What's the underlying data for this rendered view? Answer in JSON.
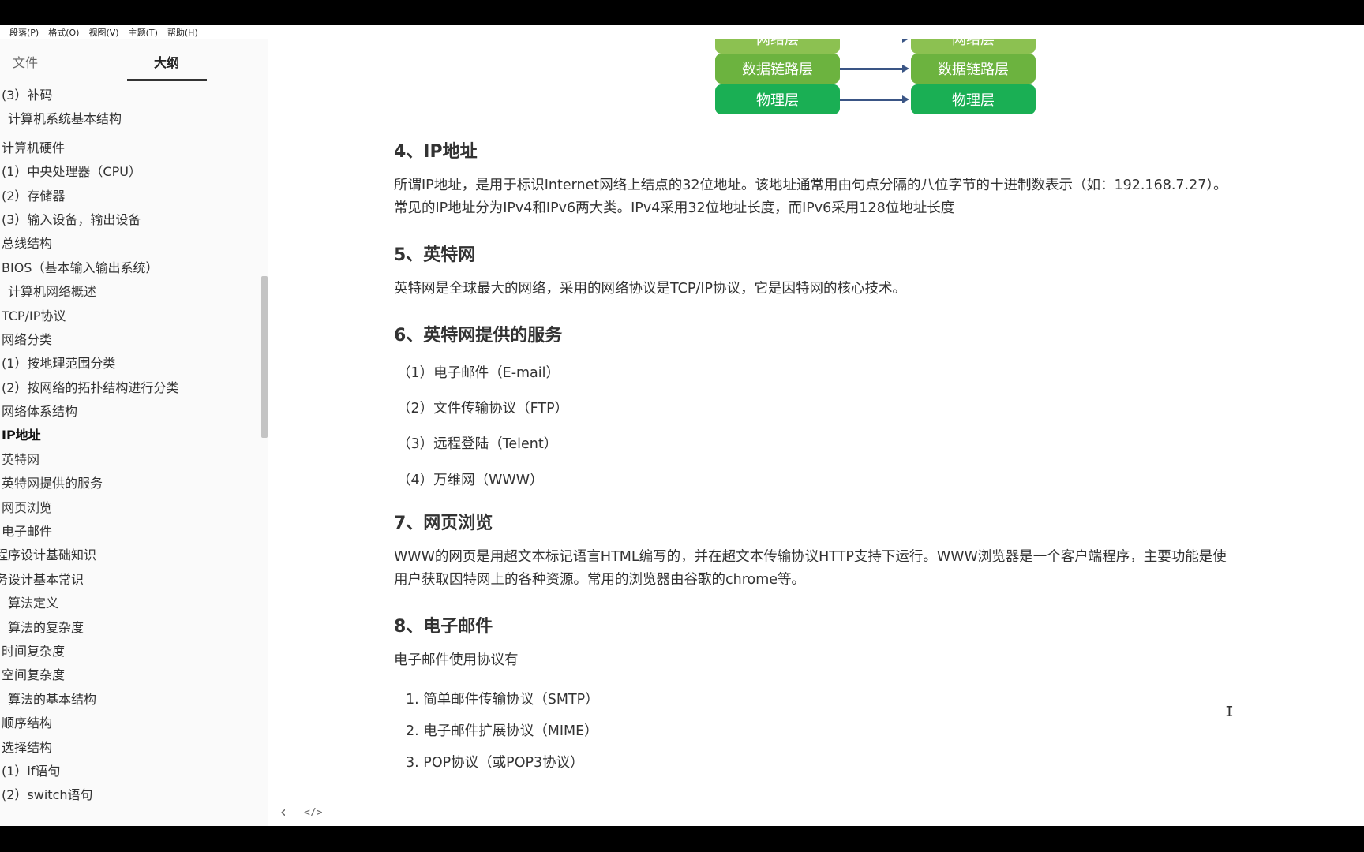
{
  "menubar": {
    "items": [
      "段落(P)",
      "格式(O)",
      "视图(V)",
      "主题(T)",
      "帮助(H)"
    ]
  },
  "sidebar": {
    "tab_files": "文件",
    "tab_outline": "大纲",
    "items": [
      "(3）补码",
      "计算机系统基本结构",
      "计算机硬件",
      "(1）中央处理器（CPU）",
      "(2）存储器",
      "(3）输入设备，输出设备",
      "总线结构",
      "BIOS（基本输入输出系统）",
      "计算机网络概述",
      "TCP/IP协议",
      "网络分类",
      "(1）按地理范围分类",
      "(2）按网络的拓扑结构进行分类",
      "网络体系结构",
      "IP地址",
      "英特网",
      "英特网提供的服务",
      "网页浏览",
      "电子邮件",
      "程序设计基础知识",
      "务设计基本常识",
      "算法定义",
      "算法的复杂度",
      "时间复杂度",
      "空间复杂度",
      "算法的基本结构",
      "顺序结构",
      "选择结构",
      "(1）if语句",
      "(2）switch语句"
    ]
  },
  "diagram": {
    "left_top": "网络层",
    "left_mid": "数据链路层",
    "left_bottom": "物理层",
    "right_top": "网络层",
    "right_mid": "数据链路层",
    "right_bottom": "物理层",
    "colors": {
      "light_green": "#8cc151",
      "mid_green": "#6cb33f",
      "bright_green": "#1aaf54",
      "arrow": "#3a5585"
    }
  },
  "doc": {
    "h4": "4、IP地址",
    "p4a": "所谓IP地址，是用于标识Internet网络上结点的32位地址。该地址通常用由句点分隔的八位字节的十进制数表示（如：192.168.7.27）。",
    "p4b": "常见的IP地址分为IPv4和IPv6两大类。IPv4采用32位地址长度，而IPv6采用128位地址长度",
    "h5": "5、英特网",
    "p5": "英特网是全球最大的网络，采用的网络协议是TCP/IP协议，它是因特网的核心技术。",
    "h6": "6、英特网提供的服务",
    "s1": "（1）电子邮件（E-mail）",
    "s2": "（2）文件传输协议（FTP）",
    "s3": "（3）远程登陆（Telent）",
    "s4": "（4）万维网（WWW）",
    "h7": "7、网页浏览",
    "p7a": "WWW的网页是用超文本标记语言HTML编写的，并在超文本传输协议HTTP支持下运行。WWW浏览器是一个客户端程序，主要功能是使",
    "p7b": "用户获取因特网上的各种资源。常用的浏览器由谷歌的chrome等。",
    "h8": "8、电子邮件",
    "p8": "电子邮件使用协议有",
    "m1": "1. 简单邮件传输协议（SMTP）",
    "m2": "2. 电子邮件扩展协议（MIME）",
    "m3": "3. POP协议（或POP3协议）"
  },
  "footer": {
    "back": "‹",
    "source": "</>"
  }
}
